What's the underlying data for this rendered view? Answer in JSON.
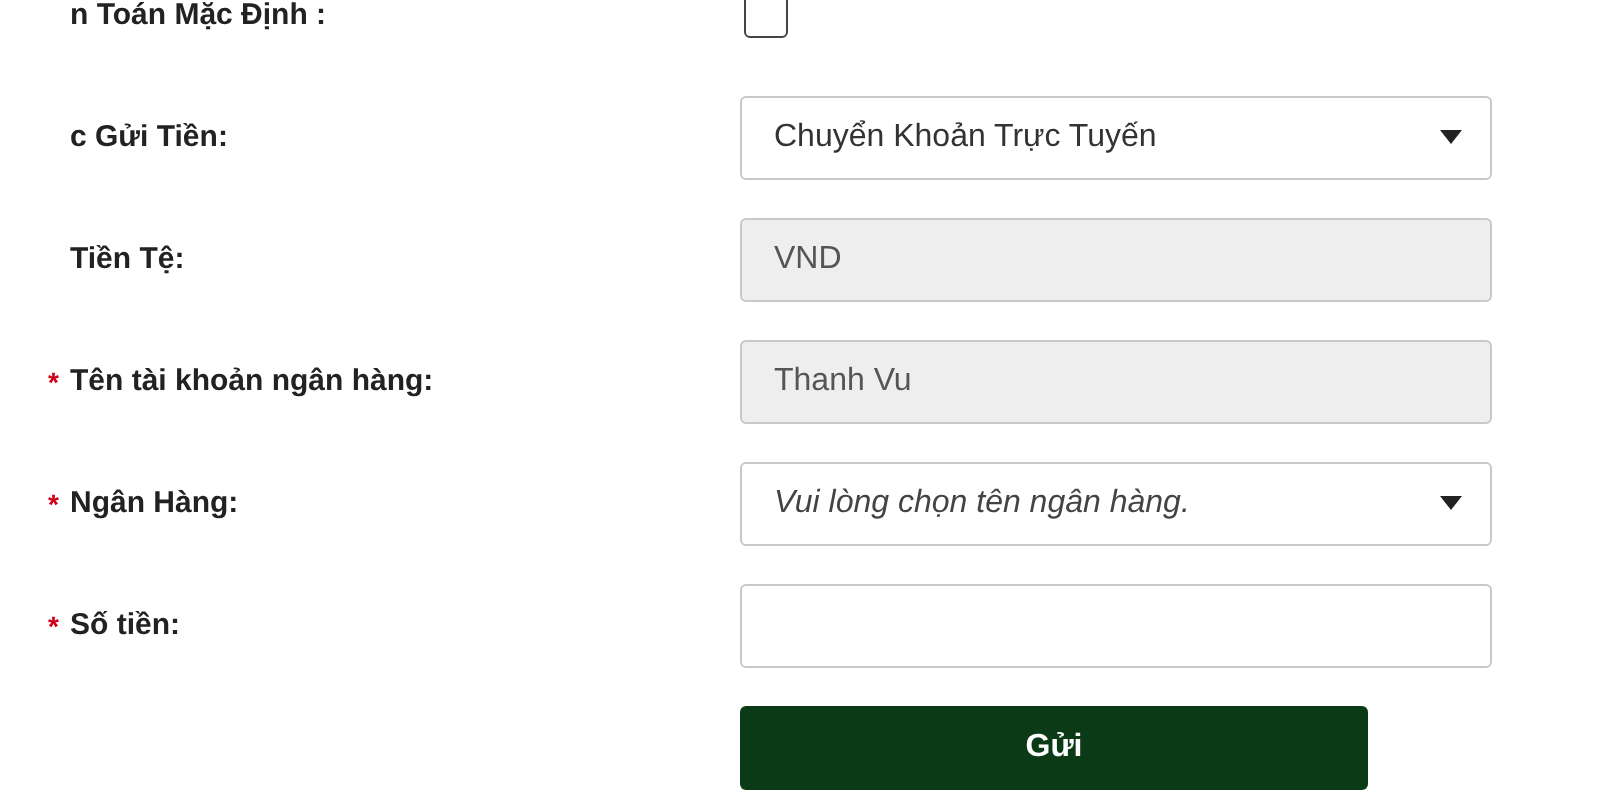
{
  "required_mark": "*",
  "fields": [
    {
      "kind": "checkbox",
      "label": "n Toán Mặc Định :",
      "required": false,
      "checked": false
    },
    {
      "kind": "select",
      "label": "c Gửi Tiền:",
      "required": false,
      "value": "Chuyển Khoản Trực Tuyến"
    },
    {
      "kind": "readonly",
      "label": "Tiền Tệ:",
      "required": false,
      "value": "VND"
    },
    {
      "kind": "readonly",
      "label": "Tên tài khoản ngân hàng:",
      "required": true,
      "value": "Thanh Vu"
    },
    {
      "kind": "select",
      "label": "Ngân Hàng:",
      "required": true,
      "placeholder": "Vui lòng chọn tên ngân hàng."
    },
    {
      "kind": "input",
      "label": "Số tiền:",
      "required": true
    }
  ],
  "submit_button": {
    "label": "Gửi"
  }
}
